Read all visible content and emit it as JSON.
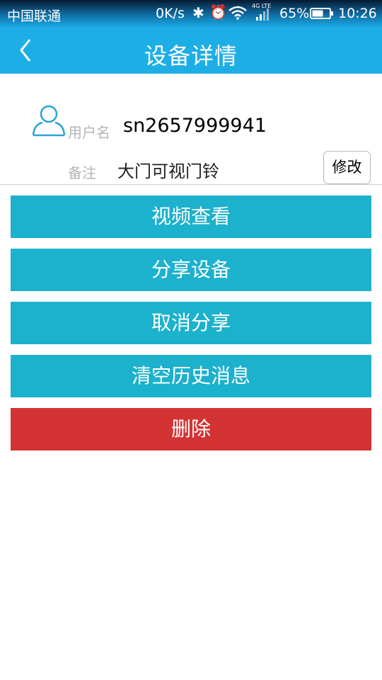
{
  "status_bar": {
    "carrier": "中国联通",
    "net_speed": "0K/s",
    "bluetooth_icon": "bluetooth-icon",
    "alarm_icon": "alarm-icon",
    "wifi_icon": "wifi-icon",
    "signal_icon": "signal-icon",
    "signal_label": "4G LTE",
    "battery_percent": "65%",
    "battery_level": 0.65,
    "time": "10:26"
  },
  "header": {
    "title": "设备详情",
    "back_icon": "chevron-left-icon"
  },
  "device": {
    "avatar_icon": "user-icon",
    "username_label": "用户名",
    "username_value": "sn2657999941",
    "remark_label": "备注",
    "remark_value": "大门可视门铃",
    "edit_label": "修改"
  },
  "actions": {
    "view_video": "视频查看",
    "share_device": "分享设备",
    "cancel_share": "取消分享",
    "clear_history": "清空历史消息",
    "delete": "删除"
  },
  "colors": {
    "header_bg": "#1eaee6",
    "action_bg": "#1cb1cd",
    "delete_bg": "#d33333",
    "avatar_stroke": "#2aa3d6"
  }
}
